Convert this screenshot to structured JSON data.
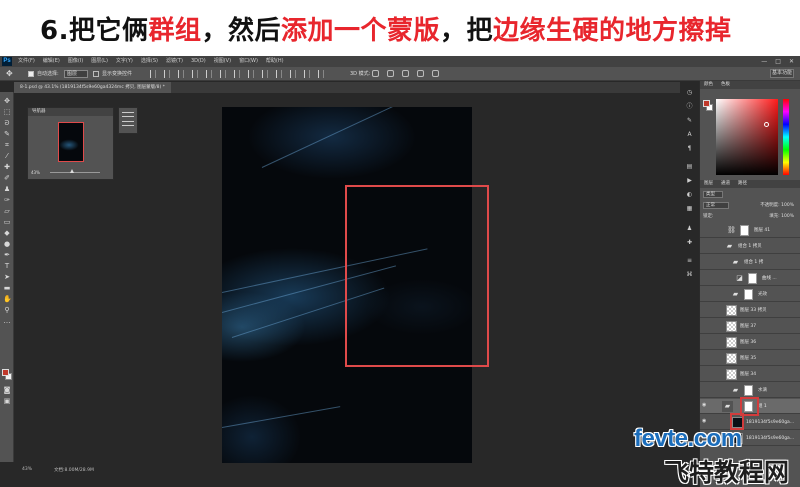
{
  "banner": {
    "part1": "6.把它俩",
    "part2": "群组",
    "part3": "，然后",
    "part4": "添加一个蒙版",
    "part5": "，把",
    "part6": "边缘生硬的地方擦掉"
  },
  "app": {
    "logo": "Ps",
    "menu": [
      "文件(F)",
      "编辑(E)",
      "图像(I)",
      "图层(L)",
      "文字(Y)",
      "选择(S)",
      "滤镜(T)",
      "3D(D)",
      "视图(V)",
      "窗口(W)",
      "帮助(H)"
    ],
    "window_controls": [
      "—",
      "□",
      "✕"
    ]
  },
  "options_bar": {
    "auto_select_label": "自动选择:",
    "auto_select_value": "图层",
    "show_transform_label": "显示变换控件",
    "mode_3d_label": "3D 模式:",
    "workspace": "基本功能"
  },
  "document": {
    "tab_label": "8-1.psd @ 43.1% (1819134f5s9e60ga4324mc 拷贝, 图层蒙版/8) *"
  },
  "navigator": {
    "title": "导航器",
    "zoom": "43%"
  },
  "panels": {
    "color_tabs": [
      "颜色",
      "色板"
    ],
    "layers_tabs": [
      "图层",
      "通道",
      "路径"
    ],
    "filter_kind": "类型",
    "blend_mode": "正常",
    "opacity_label": "不透明度: 100%",
    "lock_label": "锁定:",
    "fill_label": "填充: 100%"
  },
  "layers": [
    {
      "name": "图层 41",
      "type": "masked",
      "visible": false
    },
    {
      "name": "组合 1 拷贝",
      "type": "group",
      "visible": false
    },
    {
      "name": "组合 1 拷",
      "type": "group",
      "visible": false
    },
    {
      "name": "曲线 ...",
      "type": "adjust",
      "visible": false
    },
    {
      "name": "光效",
      "type": "group",
      "visible": false
    },
    {
      "name": "图层 33 拷贝",
      "type": "normal",
      "visible": false
    },
    {
      "name": "图层 37",
      "type": "normal",
      "visible": false
    },
    {
      "name": "图层 36",
      "type": "normal",
      "visible": false
    },
    {
      "name": "图层 35",
      "type": "normal",
      "visible": false
    },
    {
      "name": "图层 34",
      "type": "normal",
      "visible": false
    },
    {
      "name": "水滴",
      "type": "group",
      "visible": false
    },
    {
      "name": "组 1",
      "type": "group-selected",
      "visible": true
    },
    {
      "name": "1819134f5s9e60ga...",
      "type": "image",
      "visible": true
    },
    {
      "name": "1819134f5s9e60ga...",
      "type": "image",
      "visible": true
    }
  ],
  "status": {
    "zoom": "43%",
    "doc": "文档:8.00M/28.9M"
  },
  "watermark": {
    "en": "fevte.com",
    "cn": "飞特教程网"
  },
  "colors": {
    "accent_red": "#e8262d",
    "highlight_box": "#e04a4a",
    "watermark_blue": "#1b6dbb"
  }
}
